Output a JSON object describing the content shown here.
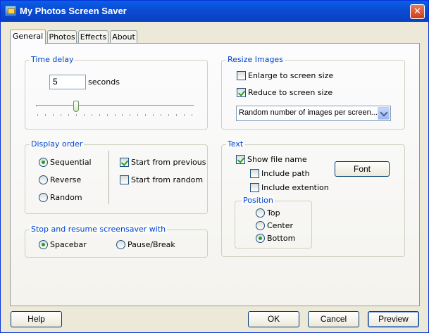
{
  "window": {
    "title": "My Photos Screen Saver"
  },
  "tabs": [
    {
      "label": "General",
      "active": true
    },
    {
      "label": "Photos",
      "active": false
    },
    {
      "label": "Effects",
      "active": false
    },
    {
      "label": "About",
      "active": false
    }
  ],
  "time_delay": {
    "legend": "Time delay",
    "value": "5",
    "unit": "seconds",
    "slider": {
      "min": 0,
      "max": 20,
      "value": 5
    }
  },
  "display_order": {
    "legend": "Display order",
    "options": [
      {
        "label": "Sequential",
        "checked": true
      },
      {
        "label": "Reverse",
        "checked": false
      },
      {
        "label": "Random",
        "checked": false
      }
    ],
    "start_from_previous": {
      "label": "Start from previous",
      "checked": true
    },
    "start_from_random": {
      "label": "Start from random",
      "checked": false
    }
  },
  "stop_resume": {
    "legend": "Stop and resume screensaver with",
    "options": [
      {
        "label": "Spacebar",
        "checked": true
      },
      {
        "label": "Pause/Break",
        "checked": false
      }
    ]
  },
  "resize": {
    "legend": "Resize Images",
    "enlarge": {
      "label": "Enlarge to screen size",
      "checked": false
    },
    "reduce": {
      "label": "Reduce to screen size",
      "checked": true
    },
    "mode_select": {
      "value": "Random number of images per screen..."
    }
  },
  "text": {
    "legend": "Text",
    "show_file_name": {
      "label": "Show file name",
      "checked": true
    },
    "include_path": {
      "label": "Include path",
      "checked": false
    },
    "include_extension": {
      "label": "Include extention",
      "checked": false
    },
    "font_button": "Font",
    "position": {
      "legend": "Position",
      "options": [
        {
          "label": "Top",
          "checked": false
        },
        {
          "label": "Center",
          "checked": false
        },
        {
          "label": "Bottom",
          "checked": true
        }
      ]
    }
  },
  "buttons": {
    "help": "Help",
    "ok": "OK",
    "cancel": "Cancel",
    "preview": "Preview"
  },
  "colors": {
    "titlebar": "#0a50d8",
    "dialog_bg": "#ece9d8",
    "group_legend": "#0046d5",
    "check_mark": "#21a121"
  }
}
